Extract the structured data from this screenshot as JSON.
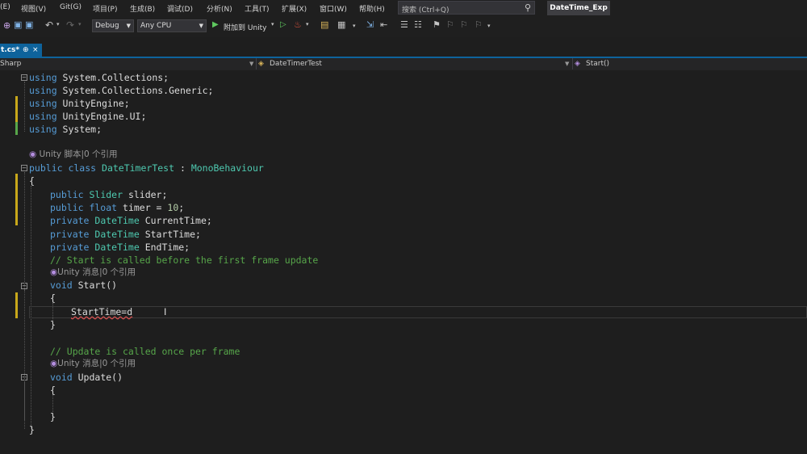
{
  "menu": [
    "(E)",
    "视图(V)",
    "Git(G)",
    "项目(P)",
    "生成(B)",
    "调试(D)",
    "分析(N)",
    "工具(T)",
    "扩展(X)",
    "窗口(W)",
    "帮助(H)"
  ],
  "search": {
    "placeholder": "搜索 (Ctrl+Q)"
  },
  "solution_name": "DateTime_Exp",
  "toolbar": {
    "config": "Debug",
    "platform": "Any CPU",
    "attach_label": "附加到 Unity"
  },
  "tab": {
    "title": "t.cs*",
    "pin": "⊕",
    "close": "×"
  },
  "navbar": {
    "project": "Sharp",
    "class": "DateTimerTest",
    "member": "Start()"
  },
  "code": {
    "u1": {
      "kw": "using",
      "rest": " System.Collections;"
    },
    "u2": {
      "kw": "using",
      "rest": " System.Collections.Generic;"
    },
    "u3": {
      "kw": "using",
      "rest": " UnityEngine;"
    },
    "u4": {
      "kw": "using",
      "rest": " UnityEngine.UI;"
    },
    "u5": {
      "kw": "using",
      "rest": " System;"
    },
    "lens_class": "Unity 脚本|0 个引用",
    "class_kw": "public class",
    "class_name": " DateTimerTest",
    "class_colon": " : ",
    "base_class": "MonoBehaviour",
    "brace_open": "{",
    "brace_close": "}",
    "f1": {
      "kw": "public",
      "type": " Slider",
      "rest": " slider;"
    },
    "f2": {
      "kw": "public float",
      "rest": " timer = ",
      "num": "10",
      "end": ";"
    },
    "f3": {
      "kw": "private",
      "type": " DateTime",
      "rest": " CurrentTime;"
    },
    "f4": {
      "kw": "private",
      "type": " DateTime",
      "rest": " StartTime;"
    },
    "f5": {
      "kw": "private",
      "type": " DateTime",
      "rest": " EndTime;"
    },
    "comment_start": "// Start is called before the first frame update",
    "lens_msg": "Unity 消息|0 个引用",
    "start_kw": "void",
    "start_name": " Start()",
    "body_line": "StartTime=d",
    "comment_update": "// Update is called once per frame",
    "update_kw": "void",
    "update_name": " Update()"
  },
  "colors": {
    "keyword": "#569cd6",
    "type": "#4ec9b0",
    "comment": "#57a64a",
    "number": "#b5cea8",
    "accent": "#0e639c",
    "change_saved": "#57a64a",
    "change_unsaved": "#c8a81a"
  }
}
